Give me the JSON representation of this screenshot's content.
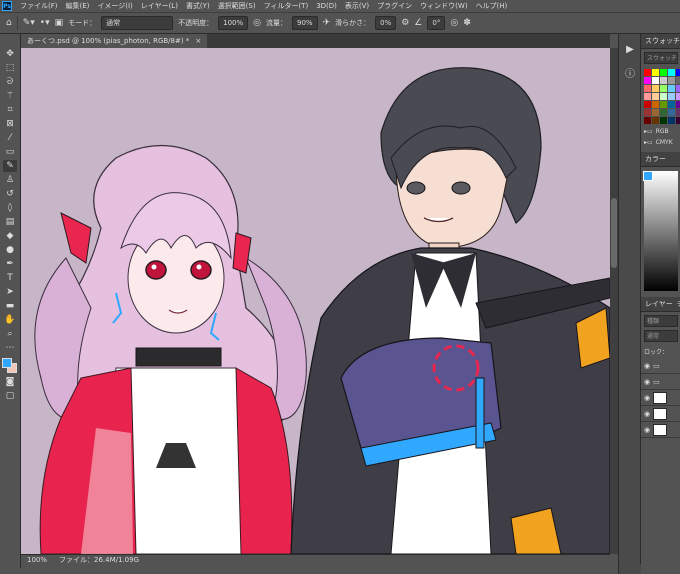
{
  "menu": [
    "ファイル(F)",
    "編集(E)",
    "イメージ(I)",
    "レイヤー(L)",
    "書式(Y)",
    "選択範囲(S)",
    "フィルター(T)",
    "3D(D)",
    "表示(V)",
    "プラグイン",
    "ウィンドウ(W)",
    "ヘルプ(H)"
  ],
  "options": {
    "mode_label": "モード：",
    "mode_value": "通常",
    "opacity_label": "不透明度：",
    "opacity_value": "100%",
    "flow_label": "流量：",
    "flow_value": "90%",
    "smoothing_label": "滑らかさ：",
    "smoothing_value": "0%",
    "angle_value": "0°"
  },
  "document": {
    "tab_title": "あーくつ.psd @ 100% (pias_photon, RGB/8#) *",
    "zoom": "100%",
    "file_info": "ファイル：26.4M/1.09G"
  },
  "panels": {
    "swatches_title": "スウォッチ",
    "swatch_search_placeholder": "スウォッチ",
    "swatch_colors": [
      "#ff0000",
      "#ffff00",
      "#00ff00",
      "#00ffff",
      "#0000ff",
      "#ff00ff",
      "#ffffff",
      "#cccccc",
      "#999999",
      "#666666",
      "#ff6666",
      "#ffcc66",
      "#99ff66",
      "#66ccff",
      "#9966ff",
      "#ff9999",
      "#ffcc99",
      "#ccffcc",
      "#99ccff",
      "#cc99ff",
      "#cc0000",
      "#cc6600",
      "#669900",
      "#006699",
      "#660099",
      "#993333",
      "#996633",
      "#336633",
      "#336699",
      "#663366",
      "#660000",
      "#663300",
      "#003300",
      "#003366",
      "#330033"
    ],
    "folder_rgb": "RGB",
    "folder_cmyk": "CMYK",
    "color_title": "カラー",
    "layers_title": "レイヤー",
    "layers_tab2": "チャ",
    "layer_search": "種類",
    "blend_mode": "通常",
    "lock_label": "ロック："
  },
  "tools": [
    "move-icon",
    "marquee-icon",
    "lasso-icon",
    "magic-wand-icon",
    "crop-icon",
    "frame-icon",
    "eyedropper-icon",
    "healing-icon",
    "brush-icon",
    "stamp-icon",
    "history-brush-icon",
    "eraser-icon",
    "gradient-icon",
    "blur-icon",
    "dodge-icon",
    "pen-icon",
    "type-icon",
    "path-select-icon",
    "shape-icon",
    "hand-icon",
    "zoom-icon",
    "more-icon"
  ]
}
